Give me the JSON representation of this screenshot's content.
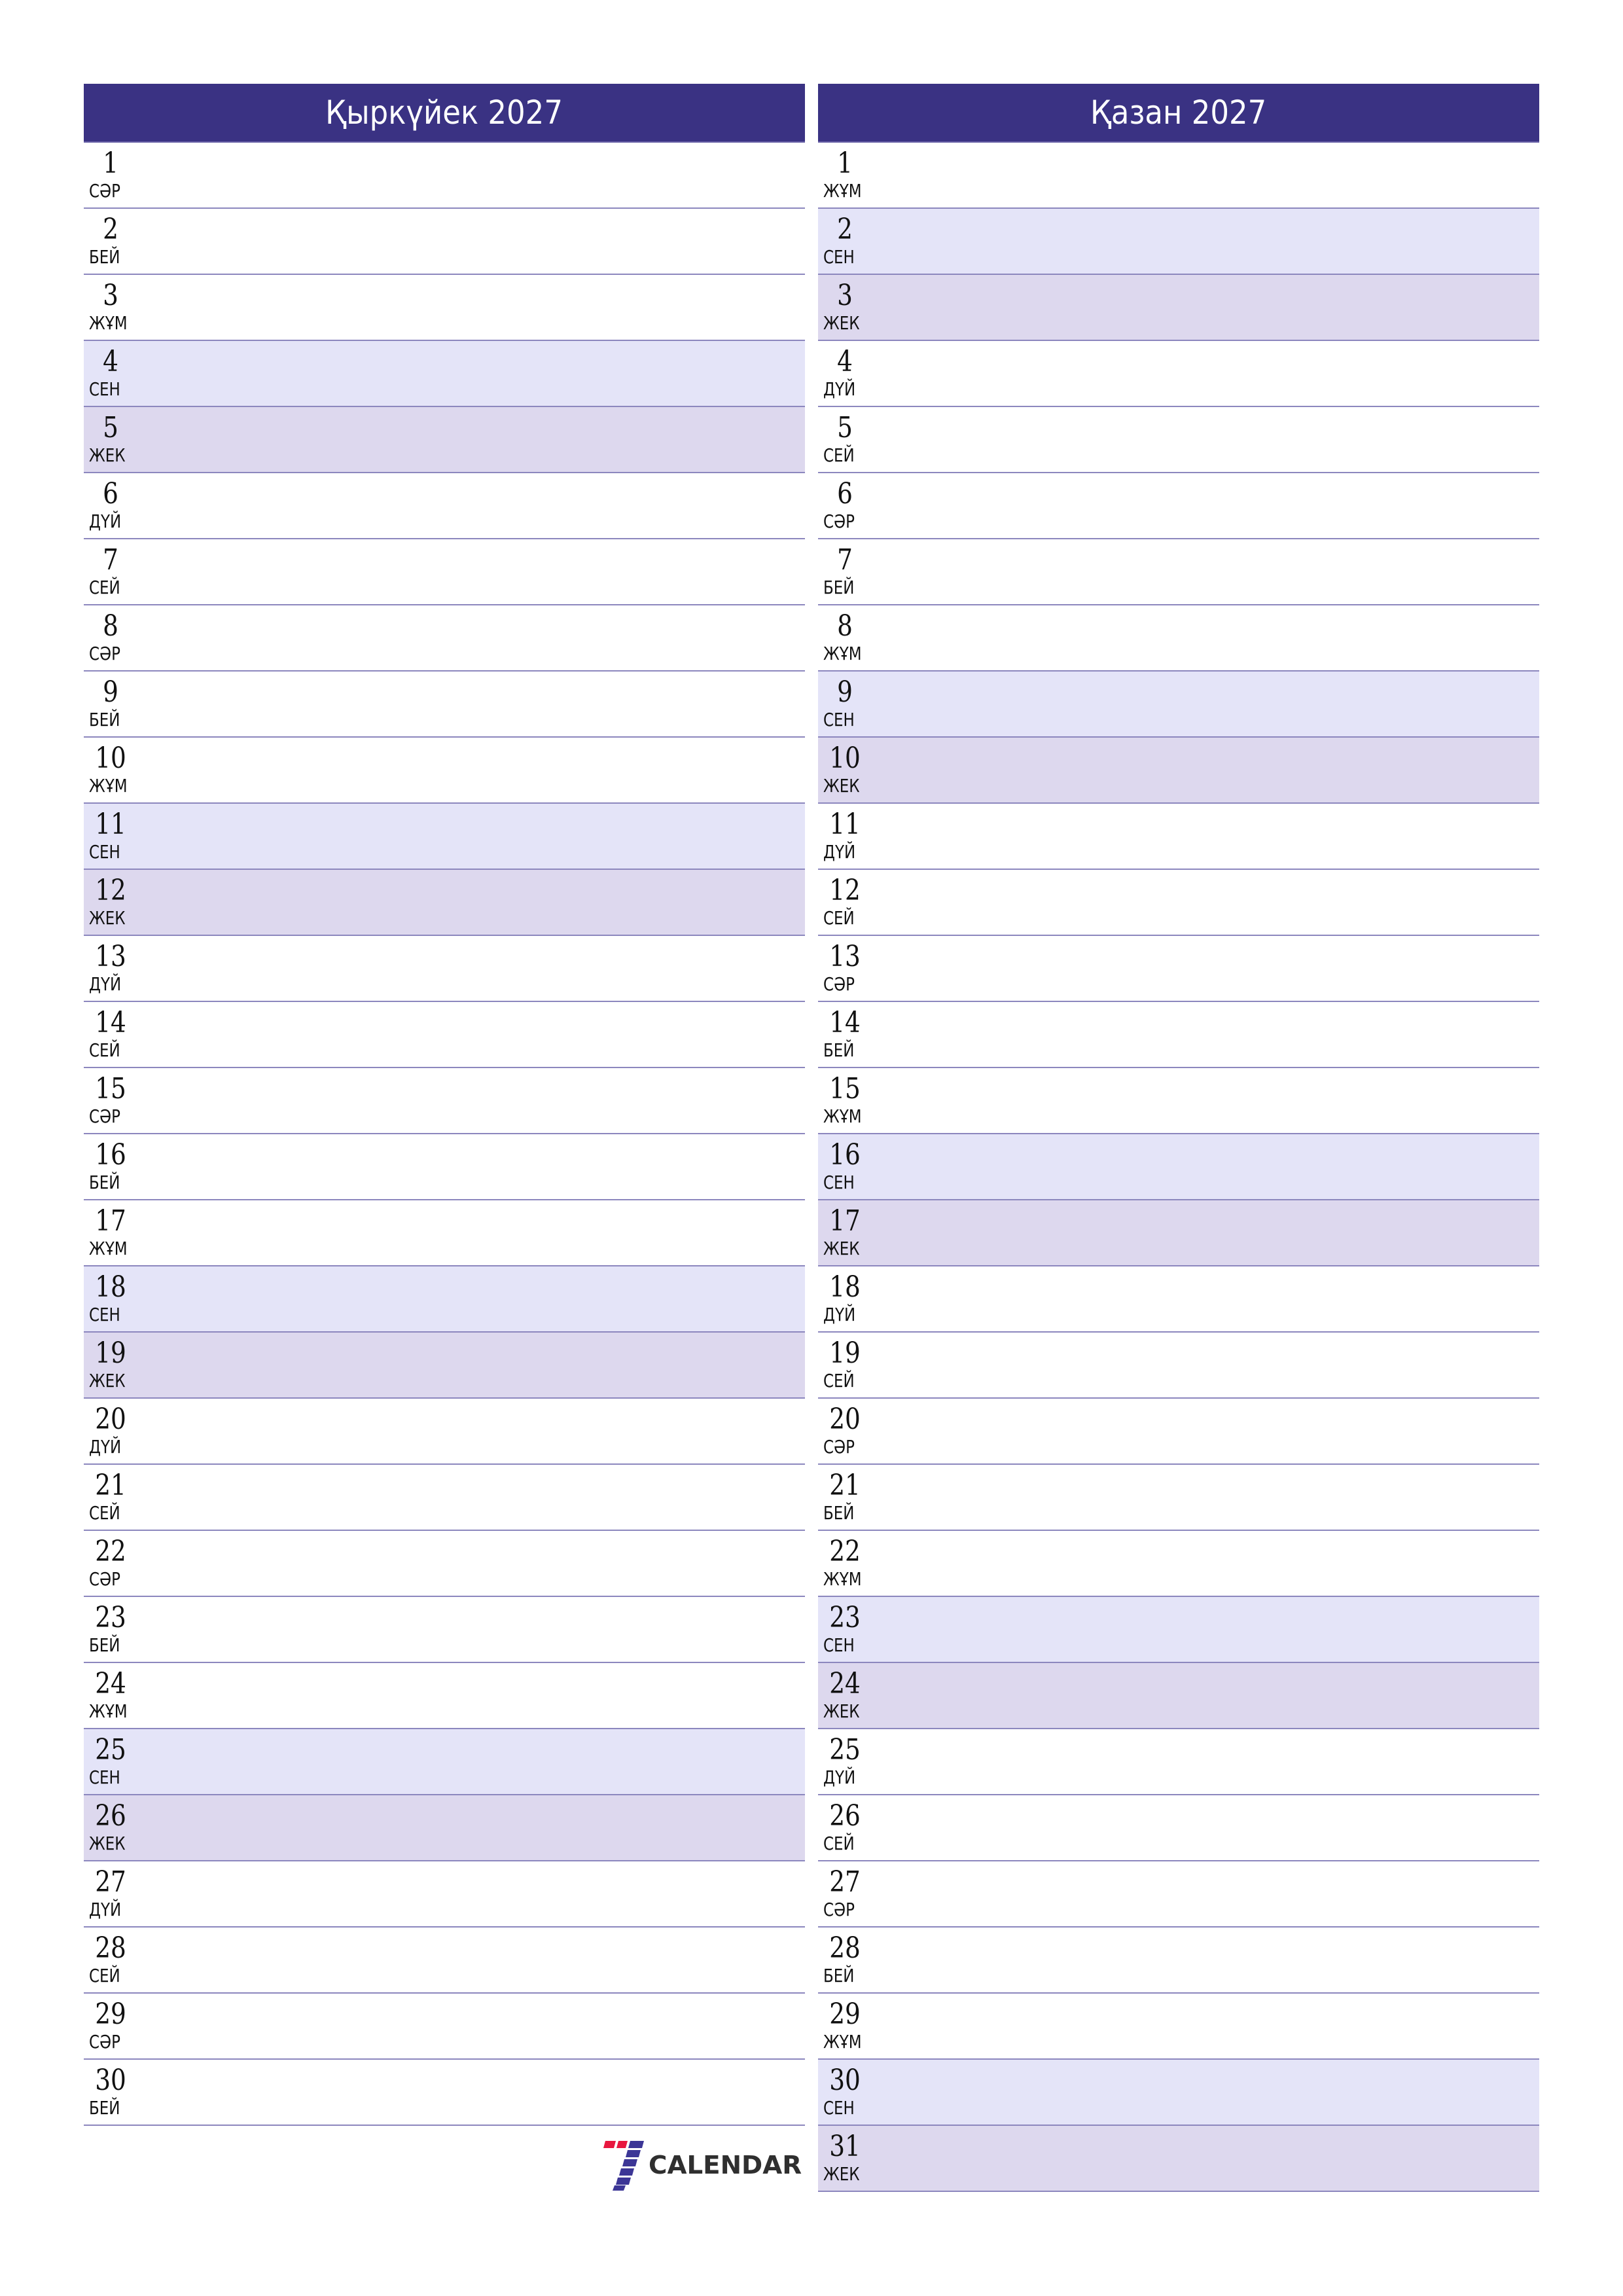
{
  "months": [
    {
      "title": "Қыркүйек 2027",
      "days": [
        {
          "day": "1",
          "weekday": "СӘР"
        },
        {
          "day": "2",
          "weekday": "БЕЙ"
        },
        {
          "day": "3",
          "weekday": "ЖҰМ"
        },
        {
          "day": "4",
          "weekday": "СЕН"
        },
        {
          "day": "5",
          "weekday": "ЖЕК"
        },
        {
          "day": "6",
          "weekday": "ДҮЙ"
        },
        {
          "day": "7",
          "weekday": "СЕЙ"
        },
        {
          "day": "8",
          "weekday": "СӘР"
        },
        {
          "day": "9",
          "weekday": "БЕЙ"
        },
        {
          "day": "10",
          "weekday": "ЖҰМ"
        },
        {
          "day": "11",
          "weekday": "СЕН"
        },
        {
          "day": "12",
          "weekday": "ЖЕК"
        },
        {
          "day": "13",
          "weekday": "ДҮЙ"
        },
        {
          "day": "14",
          "weekday": "СЕЙ"
        },
        {
          "day": "15",
          "weekday": "СӘР"
        },
        {
          "day": "16",
          "weekday": "БЕЙ"
        },
        {
          "day": "17",
          "weekday": "ЖҰМ"
        },
        {
          "day": "18",
          "weekday": "СЕН"
        },
        {
          "day": "19",
          "weekday": "ЖЕК"
        },
        {
          "day": "20",
          "weekday": "ДҮЙ"
        },
        {
          "day": "21",
          "weekday": "СЕЙ"
        },
        {
          "day": "22",
          "weekday": "СӘР"
        },
        {
          "day": "23",
          "weekday": "БЕЙ"
        },
        {
          "day": "24",
          "weekday": "ЖҰМ"
        },
        {
          "day": "25",
          "weekday": "СЕН"
        },
        {
          "day": "26",
          "weekday": "ЖЕК"
        },
        {
          "day": "27",
          "weekday": "ДҮЙ"
        },
        {
          "day": "28",
          "weekday": "СЕЙ"
        },
        {
          "day": "29",
          "weekday": "СӘР"
        },
        {
          "day": "30",
          "weekday": "БЕЙ"
        }
      ]
    },
    {
      "title": "Қазан 2027",
      "days": [
        {
          "day": "1",
          "weekday": "ЖҰМ"
        },
        {
          "day": "2",
          "weekday": "СЕН"
        },
        {
          "day": "3",
          "weekday": "ЖЕК"
        },
        {
          "day": "4",
          "weekday": "ДҮЙ"
        },
        {
          "day": "5",
          "weekday": "СЕЙ"
        },
        {
          "day": "6",
          "weekday": "СӘР"
        },
        {
          "day": "7",
          "weekday": "БЕЙ"
        },
        {
          "day": "8",
          "weekday": "ЖҰМ"
        },
        {
          "day": "9",
          "weekday": "СЕН"
        },
        {
          "day": "10",
          "weekday": "ЖЕК"
        },
        {
          "day": "11",
          "weekday": "ДҮЙ"
        },
        {
          "day": "12",
          "weekday": "СЕЙ"
        },
        {
          "day": "13",
          "weekday": "СӘР"
        },
        {
          "day": "14",
          "weekday": "БЕЙ"
        },
        {
          "day": "15",
          "weekday": "ЖҰМ"
        },
        {
          "day": "16",
          "weekday": "СЕН"
        },
        {
          "day": "17",
          "weekday": "ЖЕК"
        },
        {
          "day": "18",
          "weekday": "ДҮЙ"
        },
        {
          "day": "19",
          "weekday": "СЕЙ"
        },
        {
          "day": "20",
          "weekday": "СӘР"
        },
        {
          "day": "21",
          "weekday": "БЕЙ"
        },
        {
          "day": "22",
          "weekday": "ЖҰМ"
        },
        {
          "day": "23",
          "weekday": "СЕН"
        },
        {
          "day": "24",
          "weekday": "ЖЕК"
        },
        {
          "day": "25",
          "weekday": "ДҮЙ"
        },
        {
          "day": "26",
          "weekday": "СЕЙ"
        },
        {
          "day": "27",
          "weekday": "СӘР"
        },
        {
          "day": "28",
          "weekday": "БЕЙ"
        },
        {
          "day": "29",
          "weekday": "ЖҰМ"
        },
        {
          "day": "30",
          "weekday": "СЕН"
        },
        {
          "day": "31",
          "weekday": "ЖЕК"
        }
      ]
    }
  ],
  "weekend_styles": {
    "СЕН": "sat",
    "ЖЕК": "sun"
  },
  "colors": {
    "header": "#3A3283",
    "saturday_row": "#E4E4F8",
    "sunday_row": "#DDD8EE",
    "separator": "#8C87BE",
    "logo_red": "#E8173F",
    "logo_blue": "#3C3696"
  },
  "logo": {
    "text": "CALENDAR",
    "icon": "seven-calendar-logo-icon"
  }
}
